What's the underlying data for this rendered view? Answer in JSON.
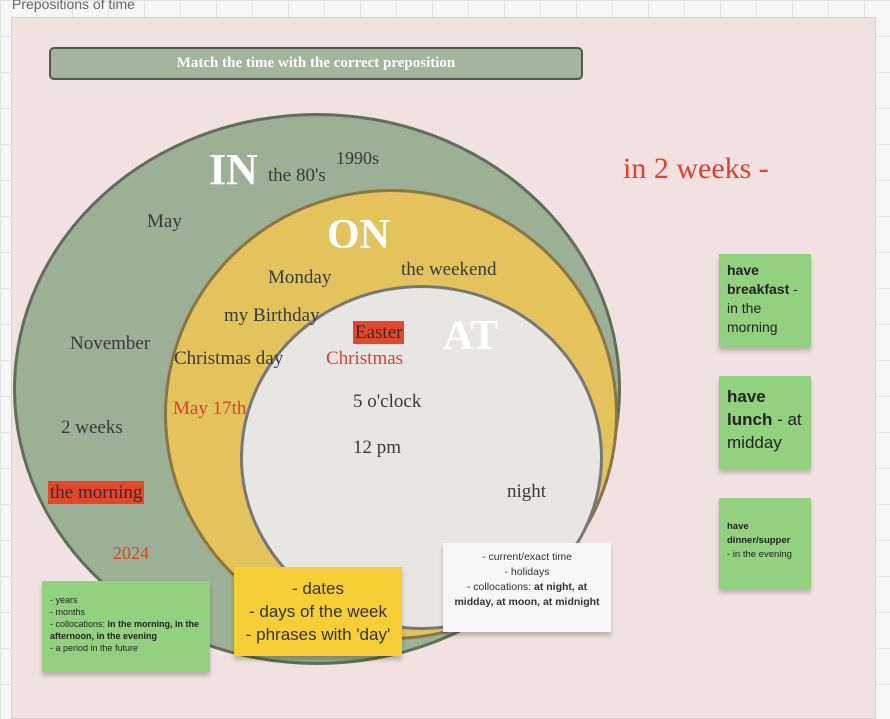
{
  "frame": {
    "title": "Prepositions of time"
  },
  "banner": {
    "text": "Match the time with the correct preposition"
  },
  "circles": {
    "in": {
      "label": "IN",
      "color": "#9bb094"
    },
    "on": {
      "label": "ON",
      "color": "#e3c35c"
    },
    "at": {
      "label": "AT",
      "color": "#e8e6e3"
    }
  },
  "words": {
    "1990s": "1990s",
    "the80s": "the 80's",
    "may": "May",
    "november": "November",
    "weeks2": "2 weeks",
    "the_morning": "the morning",
    "y2024": "2024",
    "monday": "Monday",
    "the_weekend": "the weekend",
    "my_birthday": "my Birthday",
    "christmas_day": "Christmas day",
    "may17th": "May 17th",
    "easter": "Easter",
    "christmas": "Christmas",
    "five_oclock": "5 o'clock",
    "twelve_pm": "12 pm",
    "night": "night"
  },
  "answer": {
    "text": "in 2 weeks -"
  },
  "notes": {
    "in_rules": {
      "line1": "- years",
      "line2": "- months",
      "line3_prefix": "- collocations: ",
      "line3_bold": "in the morning, in the afternoon, in the evening",
      "line4": "- a period in the future"
    },
    "on_rules": {
      "line1": "- dates",
      "line2": "- days of the week",
      "line3": "- phrases with 'day'"
    },
    "at_rules": {
      "line1": "- current/exact time",
      "line2": "- holidays",
      "line3_prefix": "- collocations: ",
      "line3_bold": "at night, at midday, at moon, at midnight"
    },
    "breakfast": {
      "bold": "have breakfast",
      "rest": " - in the morning"
    },
    "lunch": {
      "bold": "have lunch",
      "rest": " - at midday"
    },
    "dinner": {
      "bold": "have dinner/supper",
      "rest": "- in the evening"
    }
  },
  "colors": {
    "accent_red": "#e0402a",
    "note_green": "#92d27e",
    "note_yellow": "#f6cf36",
    "frame_bg": "#f1e2e1"
  }
}
